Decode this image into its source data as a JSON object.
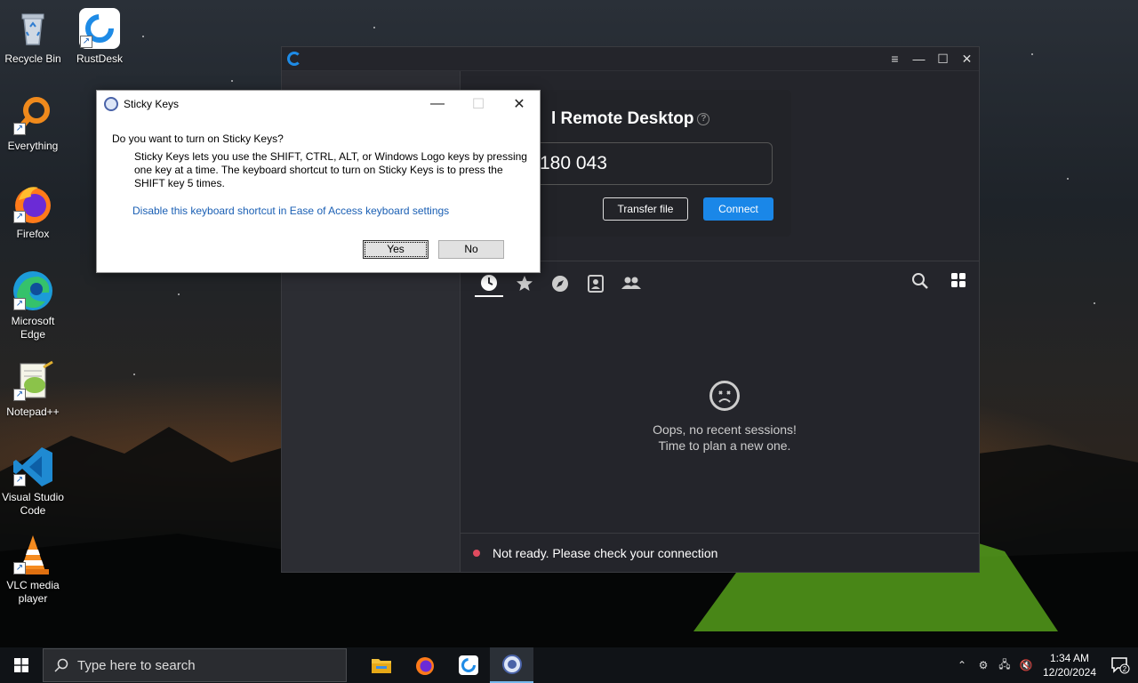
{
  "desktop": {
    "icons": [
      {
        "label": "Recycle Bin"
      },
      {
        "label": "RustDesk"
      },
      {
        "label": "Everything"
      },
      {
        "label": "Firefox"
      },
      {
        "label": "Microsoft Edge"
      },
      {
        "label": "Notepad++"
      },
      {
        "label": "Visual Studio Code"
      },
      {
        "label": "VLC media player"
      }
    ]
  },
  "rustdesk": {
    "card_title": "l Remote Desktop",
    "id_value": "180 043",
    "transfer_label": "Transfer file",
    "connect_label": "Connect",
    "empty_line1": "Oops, no recent sessions!",
    "empty_line2": "Time to plan a new one.",
    "status_text": "Not ready. Please check your connection",
    "colors": {
      "accent": "#1a87e8",
      "status_dot": "#e04b5f",
      "bg": "#24252b"
    }
  },
  "sticky_keys": {
    "title": "Sticky Keys",
    "question": "Do you want to turn on Sticky Keys?",
    "description": "Sticky Keys lets you use the SHIFT, CTRL, ALT, or Windows Logo keys by pressing one key at a time. The keyboard shortcut to turn on Sticky Keys is to press the SHIFT key 5 times.",
    "link": "Disable this keyboard shortcut in Ease of Access keyboard settings",
    "yes_label": "Yes",
    "no_label": "No"
  },
  "taskbar": {
    "search_placeholder": "Type here to search",
    "time": "1:34 AM",
    "date": "12/20/2024",
    "notification_count": "2"
  }
}
